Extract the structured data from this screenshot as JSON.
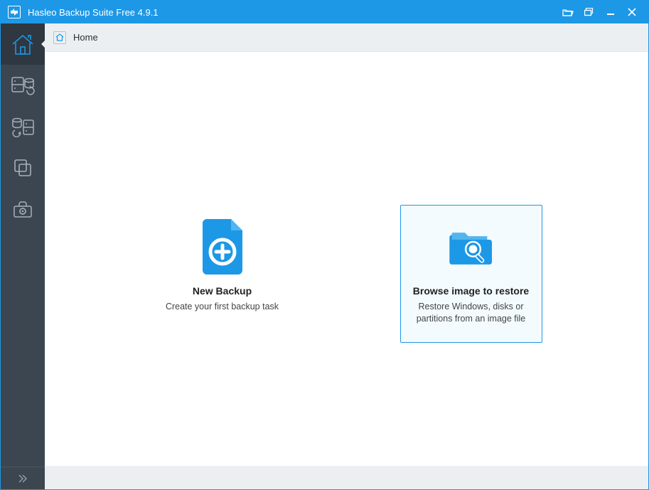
{
  "titlebar": {
    "title": "Hasleo Backup Suite Free 4.9.1"
  },
  "breadcrumb": {
    "label": "Home"
  },
  "tiles": {
    "new_backup": {
      "title": "New Backup",
      "desc": "Create your first backup task"
    },
    "browse_restore": {
      "title": "Browse image to restore",
      "desc": "Restore Windows, disks or partitions from an image file"
    }
  },
  "colors": {
    "accent": "#1d98e6",
    "sidebar_bg": "#3c4650"
  }
}
